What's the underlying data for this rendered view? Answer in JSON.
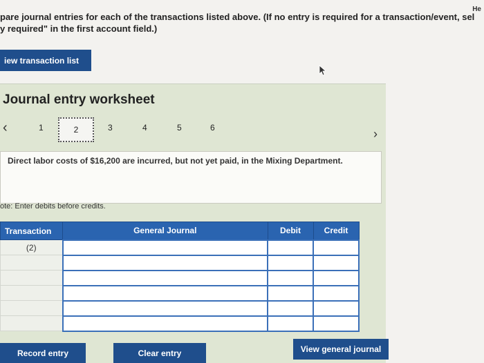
{
  "header": {
    "help_label": "He"
  },
  "instructions": {
    "line1_plain": "pare journal entries for each of the transactions listed above. ",
    "line1_bold": "(If no entry is required for a transaction/event, sel",
    "line2": "y required\" in the first account field.)"
  },
  "buttons": {
    "view_transaction_list": "iew transaction list",
    "record_entry": "Record entry",
    "clear_entry": "Clear entry",
    "view_general_journal": "View general journal"
  },
  "worksheet": {
    "title": "Journal entry worksheet",
    "pages": [
      "1",
      "2",
      "3",
      "4",
      "5",
      "6"
    ],
    "active_page": "2",
    "description": "Direct labor costs of $16,200 are incurred, but not yet paid, in the Mixing Department.",
    "note": "ote: Enter debits before credits."
  },
  "journal_table": {
    "headers": {
      "transaction": "Transaction",
      "general_journal": "General Journal",
      "debit": "Debit",
      "credit": "Credit"
    },
    "rows": [
      {
        "transaction": "(2)",
        "account": "",
        "debit": "",
        "credit": ""
      },
      {
        "transaction": "",
        "account": "",
        "debit": "",
        "credit": ""
      },
      {
        "transaction": "",
        "account": "",
        "debit": "",
        "credit": ""
      },
      {
        "transaction": "",
        "account": "",
        "debit": "",
        "credit": ""
      },
      {
        "transaction": "",
        "account": "",
        "debit": "",
        "credit": ""
      },
      {
        "transaction": "",
        "account": "",
        "debit": "",
        "credit": ""
      }
    ]
  }
}
